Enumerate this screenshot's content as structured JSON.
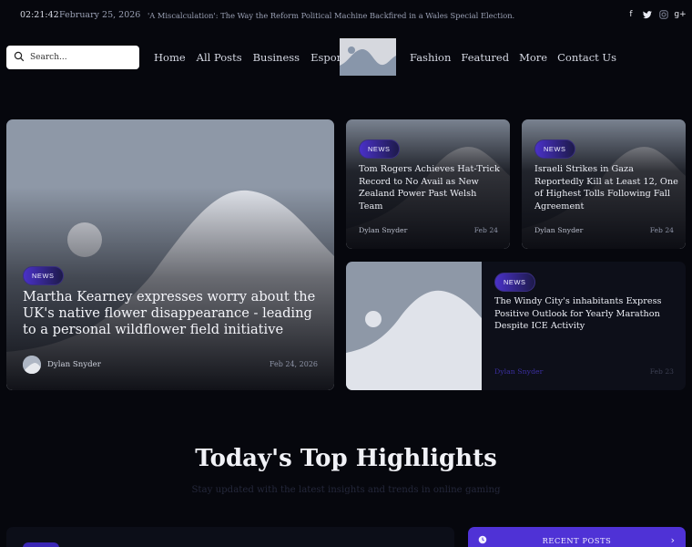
{
  "topbar": {
    "time": "02:21:42",
    "date": "February 25, 2026",
    "ticker": "'A Miscalculation': The Way the Reform Political Machine Backfired in a Wales Special Election."
  },
  "socials": [
    "facebook-icon",
    "twitter-icon",
    "instagram-icon",
    "google-plus-icon"
  ],
  "search": {
    "placeholder": "Search..."
  },
  "nav": {
    "left": [
      "Home",
      "All Posts",
      "Business",
      "Esports"
    ],
    "right": [
      "Fashion",
      "Featured",
      "More",
      "Contact Us"
    ]
  },
  "featured": {
    "badge": "NEWS",
    "title": "Martha Kearney expresses worry about the UK's native flower disappearance - leading to a personal wildflower field initiative",
    "author": "Dylan Snyder",
    "date": "Feb 24, 2026"
  },
  "cards": [
    {
      "badge": "NEWS",
      "title": "Tom Rogers Achieves Hat-Trick Record to No Avail as New Zealand Power Past Welsh Team",
      "author": "Dylan Snyder",
      "date": "Feb 24"
    },
    {
      "badge": "NEWS",
      "title": "Israeli Strikes in Gaza Reportedly Kill at Least 12, One of Highest Tolls Following Fall Agreement",
      "author": "Dylan Snyder",
      "date": "Feb 24"
    },
    {
      "badge": "NEWS",
      "title": "The Windy City's inhabitants Express Positive Outlook for Yearly Marathon Despite ICE Activity",
      "author": "Dylan Snyder",
      "date": "Feb 23"
    }
  ],
  "highlights": {
    "title": "Today's Top Highlights",
    "subtitle": "Stay updated with the latest insights and trends in online gaming"
  },
  "recent": {
    "label": "RECENT POSTS"
  },
  "colors": {
    "accent": "#4f32d6",
    "background": "#06070d"
  }
}
